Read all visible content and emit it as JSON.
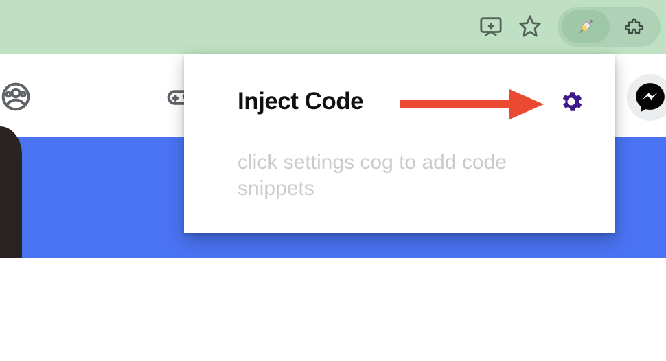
{
  "popup": {
    "title": "Inject Code",
    "hint": "click settings cog to add code snippets"
  },
  "icons": {
    "cast": "cast-icon",
    "star": "star-icon",
    "syringe": "syringe-icon",
    "puzzle": "puzzle-icon",
    "group": "group-icon",
    "gamepad": "gamepad-icon",
    "gear": "gear-icon",
    "messenger": "messenger-icon"
  },
  "colors": {
    "toolbar": "#bfe0c2",
    "blue": "#4a73f3",
    "gear": "#3d1a8a",
    "arrow": "#ea4a32"
  }
}
